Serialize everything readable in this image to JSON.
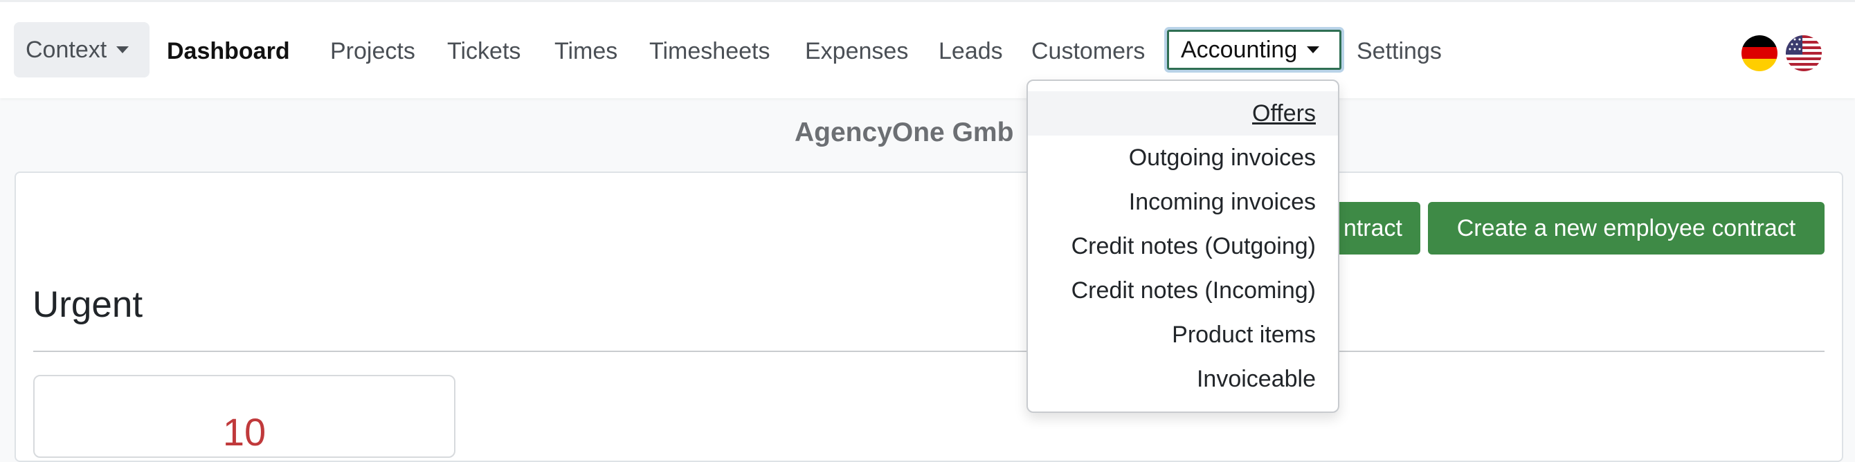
{
  "navbar": {
    "context_label": "Context",
    "items": [
      {
        "label": "Dashboard"
      },
      {
        "label": "Projects"
      },
      {
        "label": "Tickets"
      },
      {
        "label": "Times"
      },
      {
        "label": "Timesheets"
      },
      {
        "label": "Expenses"
      },
      {
        "label": "Leads"
      },
      {
        "label": "Customers"
      },
      {
        "label": "Accounting",
        "open": true
      },
      {
        "label": "Settings"
      }
    ],
    "languages": [
      {
        "icon": "germany-flag-icon",
        "colors": [
          "#000000",
          "#dd0000",
          "#ffce00"
        ]
      },
      {
        "icon": "usa-flag-icon",
        "colors": [
          "#b22234",
          "#ffffff",
          "#3c3b6e"
        ]
      }
    ]
  },
  "accounting_menu": {
    "items": [
      {
        "label": "Offers",
        "highlighted": true
      },
      {
        "label": "Outgoing invoices"
      },
      {
        "label": "Incoming invoices"
      },
      {
        "label": "Credit notes (Outgoing)"
      },
      {
        "label": "Credit notes (Incoming)"
      },
      {
        "label": "Product items"
      },
      {
        "label": "Invoiceable"
      }
    ]
  },
  "main": {
    "company_name": "AgencyOne Gmb",
    "buttons": {
      "new_contract_partial": "ntract",
      "new_employee_contract": "Create a new employee contract"
    },
    "section_title": "Urgent",
    "stat_value": "10"
  },
  "colors": {
    "accent_green": "#3e8a46",
    "active_border": "#2f6f53",
    "urgent_red": "#c0393b"
  }
}
